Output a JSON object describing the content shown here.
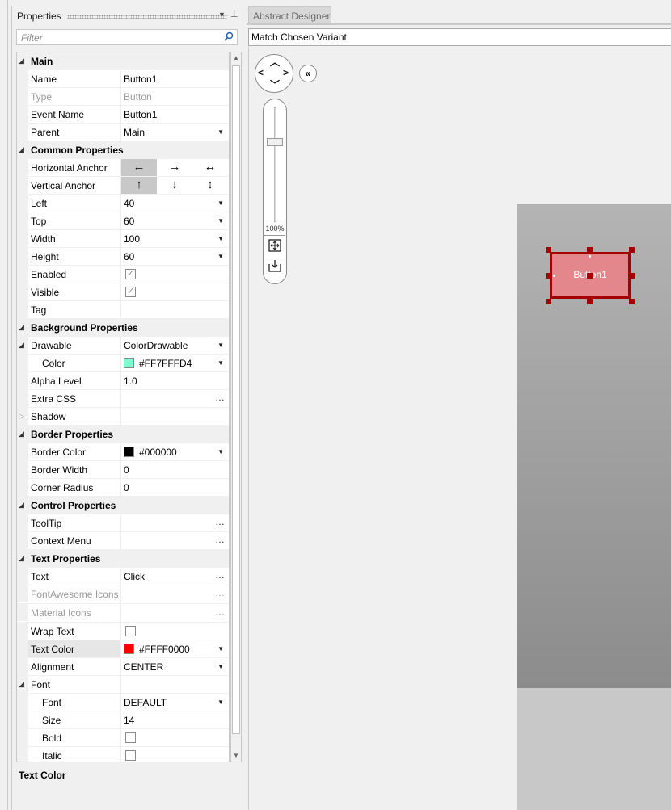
{
  "panel": {
    "title": "Properties",
    "filter_placeholder": "Filter",
    "description_title": "Text Color"
  },
  "grid": {
    "main": {
      "label": "Main"
    },
    "name": {
      "label": "Name",
      "value": "Button1"
    },
    "type": {
      "label": "Type",
      "value": "Button"
    },
    "event_name": {
      "label": "Event Name",
      "value": "Button1"
    },
    "parent": {
      "label": "Parent",
      "value": "Main"
    },
    "common": {
      "label": "Common Properties"
    },
    "h_anchor": {
      "label": "Horizontal Anchor",
      "options": [
        "←",
        "→",
        "↔"
      ],
      "selected": 0
    },
    "v_anchor": {
      "label": "Vertical Anchor",
      "options": [
        "↑",
        "↓",
        "↕"
      ],
      "selected": 0
    },
    "left": {
      "label": "Left",
      "value": "40"
    },
    "top": {
      "label": "Top",
      "value": "60"
    },
    "width": {
      "label": "Width",
      "value": "100"
    },
    "height": {
      "label": "Height",
      "value": "60"
    },
    "enabled": {
      "label": "Enabled",
      "checked": true
    },
    "visible": {
      "label": "Visible",
      "checked": true
    },
    "tag": {
      "label": "Tag",
      "value": ""
    },
    "background": {
      "label": "Background Properties"
    },
    "drawable": {
      "label": "Drawable",
      "value": "ColorDrawable"
    },
    "color": {
      "label": "Color",
      "value": "#FF7FFFD4",
      "swatch": "#7fffd4"
    },
    "alpha": {
      "label": "Alpha Level",
      "value": "1.0"
    },
    "extra_css": {
      "label": "Extra CSS",
      "value": ""
    },
    "shadow": {
      "label": "Shadow"
    },
    "border": {
      "label": "Border Properties"
    },
    "border_color": {
      "label": "Border Color",
      "value": "#000000",
      "swatch": "#000000"
    },
    "border_width": {
      "label": "Border Width",
      "value": "0"
    },
    "corner_radius": {
      "label": "Corner Radius",
      "value": "0"
    },
    "control": {
      "label": "Control Properties"
    },
    "tooltip": {
      "label": "ToolTip",
      "value": ""
    },
    "context_menu": {
      "label": "Context Menu",
      "value": ""
    },
    "text_props": {
      "label": "Text Properties"
    },
    "text": {
      "label": "Text",
      "value": "Click"
    },
    "fa_icons": {
      "label": "FontAwesome Icons",
      "value": ""
    },
    "material_icons": {
      "label": "Material Icons",
      "value": ""
    },
    "wrap_text": {
      "label": "Wrap Text",
      "checked": false
    },
    "text_color": {
      "label": "Text Color",
      "value": "#FFFF0000",
      "swatch": "#ff0000"
    },
    "alignment": {
      "label": "Alignment",
      "value": "CENTER"
    },
    "font_group": {
      "label": "Font"
    },
    "font": {
      "label": "Font",
      "value": "DEFAULT"
    },
    "size": {
      "label": "Size",
      "value": "14"
    },
    "bold": {
      "label": "Bold",
      "checked": false
    },
    "italic": {
      "label": "Italic",
      "checked": false
    }
  },
  "designer": {
    "tab_label": "Abstract Designer",
    "variant_label": "Match Chosen Variant",
    "zoom_label": "100%",
    "zoom_level": 100,
    "button_text": "Button1"
  },
  "colors": {
    "selection": "#a40000",
    "button_fill": "#e3878c"
  },
  "icons": [
    "search-icon",
    "pin-icon",
    "dropdown-arrow-icon",
    "pan-arrows-icon",
    "collapse-icon",
    "fit-screen-icon",
    "export-icon",
    "checkmark-icon",
    "ellipsis-icon"
  ]
}
